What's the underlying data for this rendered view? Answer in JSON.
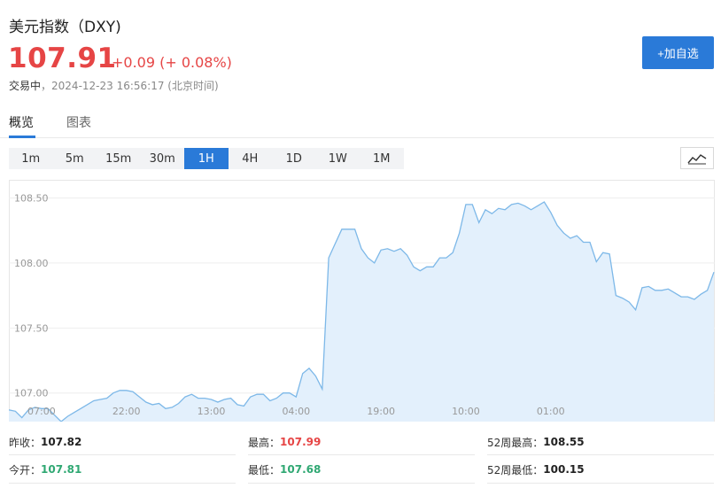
{
  "header": {
    "title": "美元指数（DXY)",
    "price": "107.91",
    "change": "+0.09 (+ 0.08%)",
    "trade_status": "交易中",
    "separator": "，",
    "timestamp": "2024-12-23 16:56:17 (北京时间)",
    "add_button": "+加自选"
  },
  "tabs": [
    {
      "label": "概览",
      "active": true
    },
    {
      "label": "图表",
      "active": false
    }
  ],
  "periods": [
    {
      "label": "1m",
      "active": false
    },
    {
      "label": "5m",
      "active": false
    },
    {
      "label": "15m",
      "active": false
    },
    {
      "label": "30m",
      "active": false
    },
    {
      "label": "1H",
      "active": true
    },
    {
      "label": "4H",
      "active": false
    },
    {
      "label": "1D",
      "active": false
    },
    {
      "label": "1W",
      "active": false
    },
    {
      "label": "1M",
      "active": false
    }
  ],
  "chart_icon": "line-chart-icon",
  "colors": {
    "accent": "#2a7ad8",
    "up": "#e64545",
    "down": "#30a873",
    "line": "#7db8e8",
    "fill": "#e3f0fc"
  },
  "chart_data": {
    "type": "area",
    "ylim": [
      106.78,
      108.64
    ],
    "yticks": [
      "108.50",
      "108.00",
      "107.50",
      "107.00"
    ],
    "ytick_values": [
      108.5,
      108.0,
      107.5,
      107.0
    ],
    "xticks": [
      "07:00",
      "22:00",
      "13:00",
      "04:00",
      "19:00",
      "10:00",
      "01:00"
    ],
    "xtick_index": [
      5,
      18,
      31,
      44,
      57,
      70,
      83
    ],
    "grid": true,
    "values": [
      106.87,
      106.86,
      106.81,
      106.87,
      106.89,
      106.88,
      106.88,
      106.83,
      106.78,
      106.82,
      106.85,
      106.88,
      106.91,
      106.94,
      106.95,
      106.96,
      107.0,
      107.02,
      107.02,
      107.01,
      106.97,
      106.93,
      106.91,
      106.92,
      106.88,
      106.89,
      106.92,
      106.97,
      106.99,
      106.96,
      106.96,
      106.95,
      106.93,
      106.95,
      106.96,
      106.91,
      106.9,
      106.97,
      106.99,
      106.99,
      106.94,
      106.96,
      107.0,
      107.0,
      106.97,
      107.15,
      107.19,
      107.13,
      107.03,
      108.04,
      108.15,
      108.26,
      108.26,
      108.26,
      108.11,
      108.04,
      108.0,
      108.1,
      108.11,
      108.09,
      108.11,
      108.06,
      107.97,
      107.94,
      107.97,
      107.97,
      108.04,
      108.04,
      108.08,
      108.23,
      108.45,
      108.45,
      108.31,
      108.41,
      108.38,
      108.42,
      108.41,
      108.45,
      108.46,
      108.44,
      108.41,
      108.44,
      108.47,
      108.39,
      108.29,
      108.23,
      108.19,
      108.21,
      108.16,
      108.16,
      108.01,
      108.08,
      108.07,
      107.75,
      107.73,
      107.7,
      107.64,
      107.81,
      107.82,
      107.79,
      107.79,
      107.8,
      107.77,
      107.74,
      107.74,
      107.72,
      107.76,
      107.79,
      107.93
    ]
  },
  "stats": {
    "prev_close": {
      "label": "昨收：",
      "value": "107.82"
    },
    "high": {
      "label": "最高：",
      "value": "107.99"
    },
    "w52_high": {
      "label": "52周最高：",
      "value": "108.55"
    },
    "open": {
      "label": "今开：",
      "value": "107.81"
    },
    "low": {
      "label": "最低：",
      "value": "107.68"
    },
    "w52_low": {
      "label": "52周最低：",
      "value": "100.15"
    }
  }
}
